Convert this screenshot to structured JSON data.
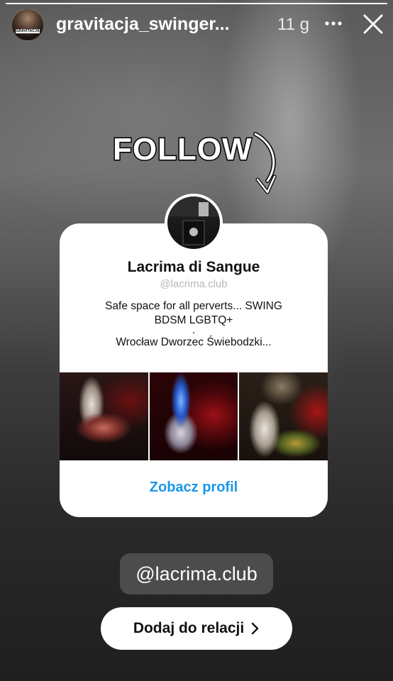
{
  "story": {
    "progress": 1.0,
    "username": "gravitacja_swinger...",
    "time_ago": "11 g",
    "avatar_text": "GRAVITACJA",
    "icons": {
      "more": "more-horizontal-icon",
      "close": "close-icon",
      "chevron": "chevron-right-icon"
    }
  },
  "sticker": {
    "follow_text": "FOLLOW",
    "follow_icon": "follow-arrow-doodle"
  },
  "profile_card": {
    "name": "Lacrima di Sangue",
    "handle": "@lacrima.club",
    "bio_line_1": "Safe space for all perverts...  SWING",
    "bio_line_2": "BDSM LGBTQ+",
    "bio_line_3": ".",
    "bio_line_4": "Wrocław Dworzec Świebodzki...",
    "link_label": "Zobacz profil",
    "link_color": "#1a97e8"
  },
  "mention": {
    "text": "@lacrima.club"
  },
  "add_to_story": {
    "label": "Dodaj do relacji"
  }
}
